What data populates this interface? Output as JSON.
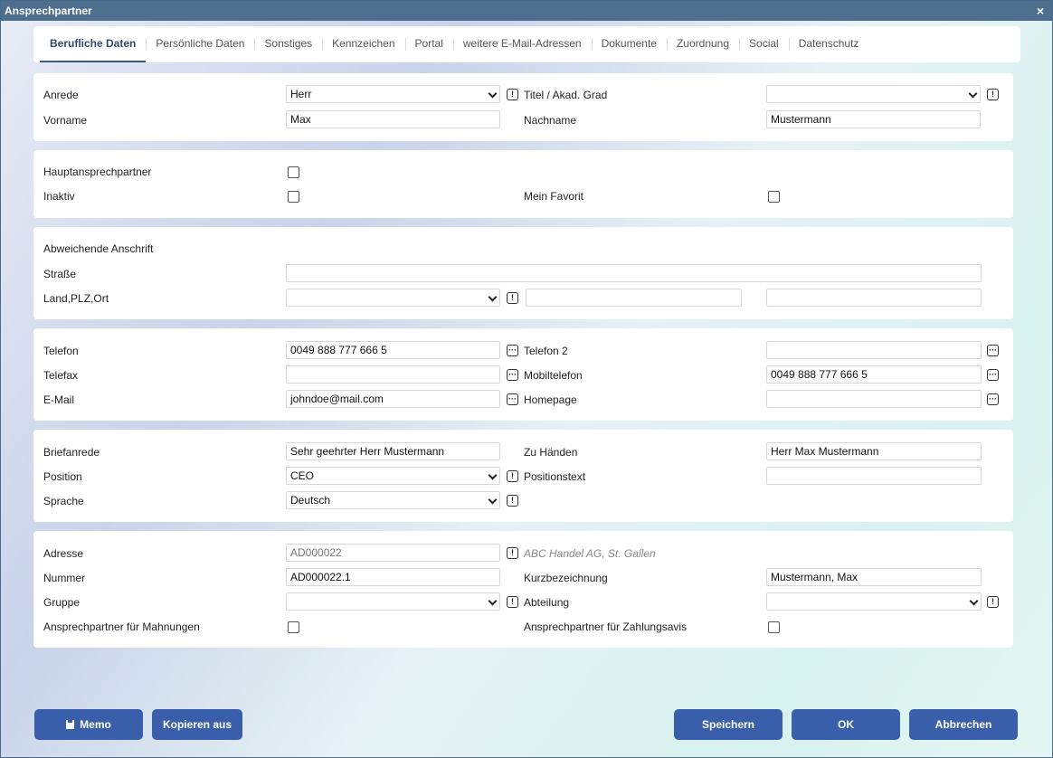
{
  "window": {
    "title": "Ansprechpartner",
    "close_glyph": "×"
  },
  "tabs": [
    {
      "label": "Berufliche Daten",
      "active": true
    },
    {
      "label": "Persönliche Daten"
    },
    {
      "label": "Sonstiges"
    },
    {
      "label": "Kennzeichen"
    },
    {
      "label": "Portal"
    },
    {
      "label": "weitere E-Mail-Adressen"
    },
    {
      "label": "Dokumente"
    },
    {
      "label": "Zuordnung"
    },
    {
      "label": "Social"
    },
    {
      "label": "Datenschutz"
    }
  ],
  "name": {
    "anrede_label": "Anrede",
    "anrede_value": "Herr",
    "titel_label": "Titel / Akad. Grad",
    "titel_value": "",
    "vorname_label": "Vorname",
    "vorname_value": "Max",
    "nachname_label": "Nachname",
    "nachname_value": "Mustermann"
  },
  "flags": {
    "haupt_label": "Hauptansprechpartner",
    "haupt_checked": false,
    "inaktiv_label": "Inaktiv",
    "inaktiv_checked": false,
    "favorit_label": "Mein Favorit",
    "favorit_checked": false
  },
  "address": {
    "section_label": "Abweichende Anschrift",
    "strasse_label": "Straße",
    "strasse_value": "",
    "land_label": "Land,PLZ,Ort",
    "land_value": "",
    "plz_value": "",
    "ort_value": ""
  },
  "contact": {
    "telefon_label": "Telefon",
    "telefon_value": "0049 888 777 666 5",
    "telefon2_label": "Telefon 2",
    "telefon2_value": "",
    "telefax_label": "Telefax",
    "telefax_value": "",
    "mobil_label": "Mobiltelefon",
    "mobil_value": "0049 888 777 666 5",
    "email_label": "E-Mail",
    "email_value": "johndoe@mail.com",
    "homepage_label": "Homepage",
    "homepage_value": ""
  },
  "letter": {
    "briefanrede_label": "Briefanrede",
    "briefanrede_value": "Sehr geehrter Herr Mustermann",
    "zuhaenden_label": "Zu Händen",
    "zuhaenden_value": "Herr Max Mustermann",
    "position_label": "Position",
    "position_value": "CEO",
    "positionstext_label": "Positionstext",
    "positionstext_value": "",
    "sprache_label": "Sprache",
    "sprache_value": "Deutsch"
  },
  "assignment": {
    "adresse_label": "Adresse",
    "adresse_value": "AD000022",
    "adresse_hint": "ABC Handel AG, St. Gallen",
    "nummer_label": "Nummer",
    "nummer_value": "AD000022.1",
    "kurz_label": "Kurzbezeichnung",
    "kurz_value": "Mustermann, Max",
    "gruppe_label": "Gruppe",
    "gruppe_value": "",
    "abteilung_label": "Abteilung",
    "abteilung_value": "",
    "mahnung_label": "Ansprechpartner für Mahnungen",
    "mahnung_checked": false,
    "zahlung_label": "Ansprechpartner für Zahlungsavis",
    "zahlung_checked": false
  },
  "buttons": {
    "memo": "Memo",
    "kopieren": "Kopieren aus",
    "speichern": "Speichern",
    "ok": "OK",
    "abbrechen": "Abbrechen"
  },
  "icons": {
    "info_glyph": "!",
    "more_glyph": "···"
  },
  "colors": {
    "titlebar": "#4d6e8d",
    "button": "#3a5faa",
    "active_tab": "#2c4b6d"
  }
}
